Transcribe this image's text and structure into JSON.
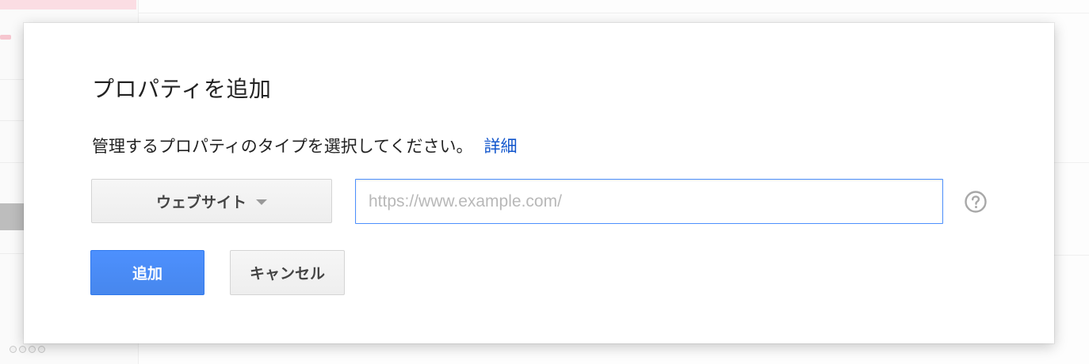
{
  "dialog": {
    "title": "プロパティを追加",
    "description": "管理するプロパティのタイプを選択してください。",
    "details_link": "詳細",
    "property_type": {
      "selected": "ウェブサイト"
    },
    "url_input": {
      "value": "",
      "placeholder": "https://www.example.com/"
    },
    "help_icon": "question-circle-icon",
    "add_button": "追加",
    "cancel_button": "キャンセル"
  },
  "colors": {
    "primary": "#4d90fe",
    "link": "#1155cc",
    "text": "#222222"
  }
}
